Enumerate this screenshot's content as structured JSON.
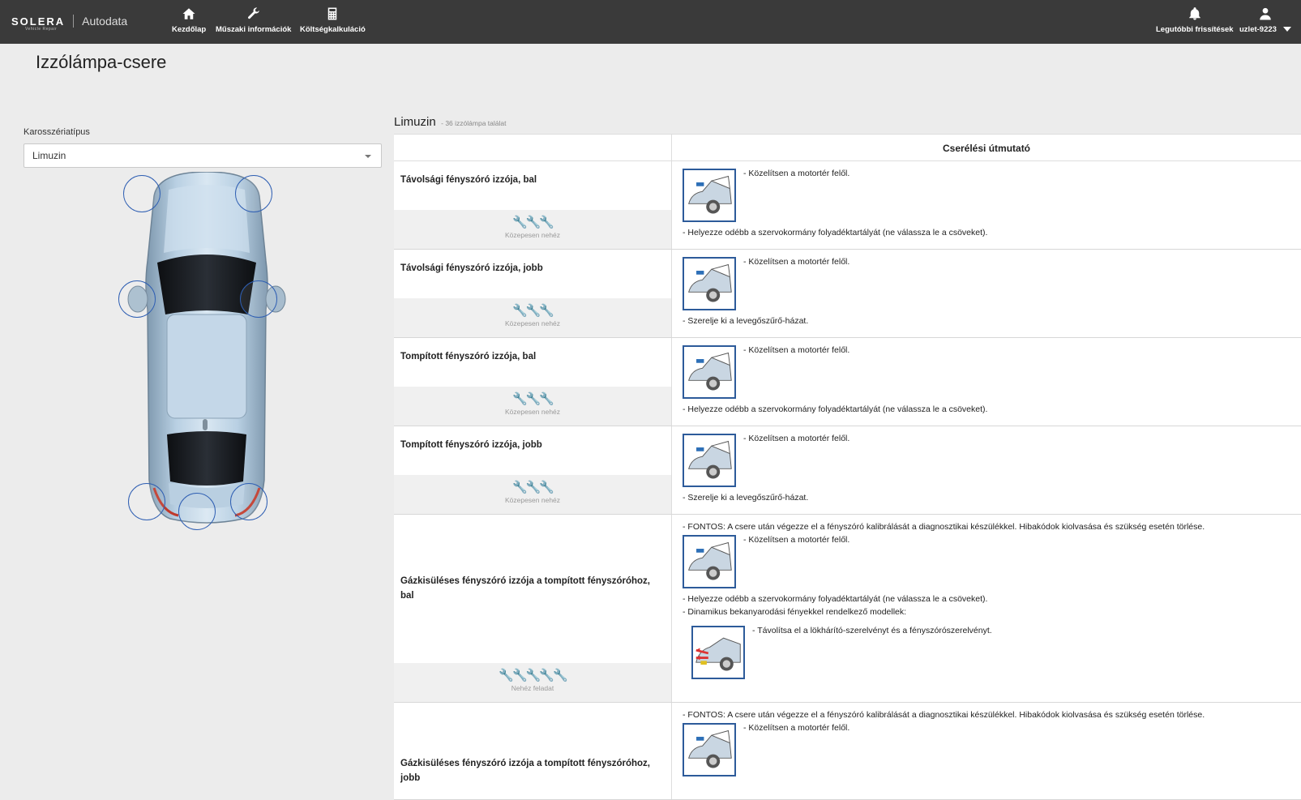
{
  "header": {
    "brand": "SOLERA",
    "brand_tag": "Vehicle Repair",
    "app_name": "Autodata",
    "nav": [
      {
        "label": "Kezdőlap",
        "icon": "home-icon"
      },
      {
        "label": "Műszaki információk",
        "icon": "wrench-icon"
      },
      {
        "label": "Költségkalkuláció",
        "icon": "calculator-icon"
      }
    ],
    "updates_label": "Legutóbbi frissítések",
    "user_label": "uzlet-9223"
  },
  "page": {
    "title": "Izzólámpa-csere"
  },
  "filter": {
    "body_type_label": "Karosszériatípus",
    "body_type_value": "Limuzin"
  },
  "results": {
    "title": "Limuzin",
    "count_text": "- 36 izzólámpa találat",
    "column_guide": "Cserélési útmutató",
    "rows": [
      {
        "name": "Távolsági fényszóró izzója, bal",
        "difficulty": "Közepesen nehéz",
        "steps": [
          "- Közelítsen a motortér felől.",
          "- Helyezze odébb a szervokormány folyadéktartályát (ne válassza le a csöveket)."
        ]
      },
      {
        "name": "Távolsági fényszóró izzója, jobb",
        "difficulty": "Közepesen nehéz",
        "steps": [
          "- Közelítsen a motortér felől.",
          "- Szerelje ki a levegőszűrő-házat."
        ]
      },
      {
        "name": "Tompított fényszóró izzója, bal",
        "difficulty": "Közepesen nehéz",
        "steps": [
          "- Közelítsen a motortér felől.",
          "- Helyezze odébb a szervokormány folyadéktartályát (ne válassza le a csöveket)."
        ]
      },
      {
        "name": "Tompított fényszóró izzója, jobb",
        "difficulty": "Közepesen nehéz",
        "steps": [
          "- Közelítsen a motortér felől.",
          "- Szerelje ki a levegőszűrő-házat."
        ]
      },
      {
        "name": "Gázkisüléses fényszóró izzója a tompított fényszóróhoz, bal",
        "difficulty": "Nehéz feladat",
        "steps": [
          "- FONTOS: A csere után végezze el a fényszóró kalibrálását a diagnosztikai készülékkel. Hibakódok kiolvasása és szükség esetén törlése.",
          "- Közelítsen a motortér felől.",
          "- Helyezze odébb a szervokormány folyadéktartályát (ne válassza le a csöveket).",
          "- Dinamikus bekanyarodási fényekkel rendelkező modellek:",
          "- Távolítsa el a lökhárító-szerelvényt és a fényszórószerelvényt."
        ]
      },
      {
        "name": "Gázkisüléses fényszóró izzója a tompított fényszóróhoz, jobb",
        "difficulty": "",
        "steps": [
          "- FONTOS: A csere után végezze el a fényszóró kalibrálását a diagnosztikai készülékkel. Hibakódok kiolvasása és szükség esetén törlése.",
          "- Közelítsen a motortér felől."
        ]
      }
    ]
  }
}
